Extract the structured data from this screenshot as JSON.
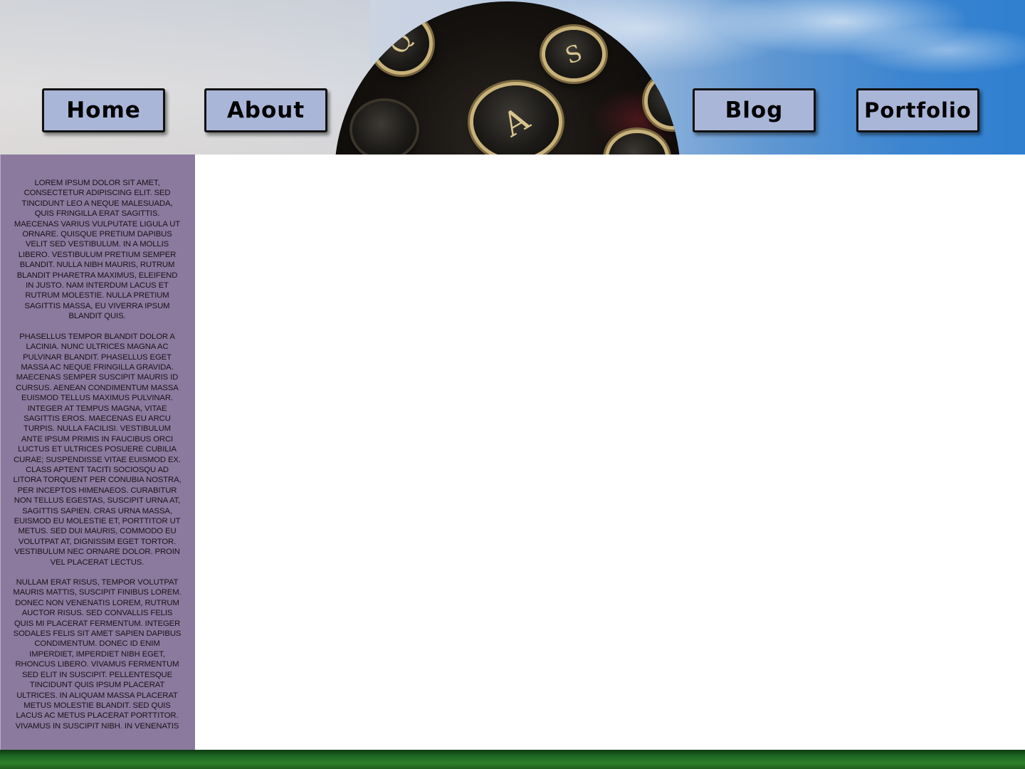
{
  "nav": {
    "home": "Home",
    "about": "About",
    "blog": "Blog",
    "portfolio": "Portfolio"
  },
  "header_image": {
    "keys": [
      "Q",
      "S",
      "A"
    ]
  },
  "sidebar": {
    "paragraphs": [
      "Lorem ipsum dolor sit amet, consectetur adipiscing elit. Sed tincidunt leo a neque malesuada, quis fringilla erat sagittis. Maecenas varius vulputate ligula ut ornare. Quisque pretium dapibus velit sed vestibulum. In a mollis libero. Vestibulum pretium semper blandit. Nulla nibh mauris, rutrum blandit pharetra maximus, eleifend in justo. Nam interdum lacus et rutrum molestie. Nulla pretium sagittis massa, eu viverra ipsum blandit quis.",
      "Phasellus tempor blandit dolor a lacinia. Nunc ultrices magna ac pulvinar blandit. Phasellus eget massa ac neque fringilla gravida. Maecenas semper suscipit mauris id cursus. Aenean condimentum massa euismod tellus maximus pulvinar. Integer at tempus magna, vitae sagittis eros. Maecenas eu arcu turpis. Nulla facilisi. Vestibulum ante ipsum primis in faucibus orci luctus et ultrices posuere cubilia curae; Suspendisse vitae euismod ex. Class aptent taciti sociosqu ad litora torquent per conubia nostra, per inceptos himenaeos. Curabitur non tellus egestas, suscipit urna at, sagittis sapien. Cras urna massa, euismod eu molestie et, porttitor ut metus. Sed dui mauris, commodo eu volutpat at, dignissim eget tortor. Vestibulum nec ornare dolor. Proin vel placerat lectus.",
      "Nullam erat risus, tempor volutpat mauris mattis, suscipit finibus lorem. Donec non venenatis lorem, rutrum auctor risus. Sed convallis felis quis mi placerat fermentum. Integer sodales felis sit amet sapien dapibus condimentum. Donec id enim imperdiet, imperdiet nibh eget, rhoncus libero. Vivamus fermentum sed elit in suscipit. Pellentesque tincidunt quis ipsum placerat ultrices. In aliquam massa placerat metus molestie blandit. Sed quis lacus ac metus placerat porttitor. Vivamus in suscipit nibh. In venenatis"
    ]
  },
  "colors": {
    "nav_button_bg": "#aab6d8",
    "sidebar_bg": "#8c799e",
    "main_bg": "#ffffff",
    "footer_grass": "#2e7f2a"
  }
}
